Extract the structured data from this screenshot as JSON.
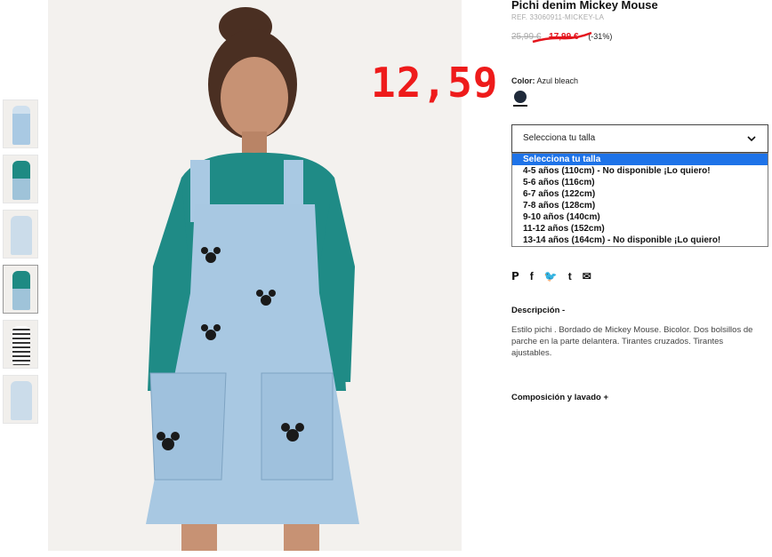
{
  "product": {
    "title": "Pichi denim Mickey Mouse",
    "ref": "REF. 33060911-MICKEY-LA",
    "old_price": "25,99 €",
    "sale_price": "17,99 €",
    "discount": "(-31%)",
    "overlay_price": "12,59",
    "color_label": "Color:",
    "color_value": "Azul bleach"
  },
  "size_select": {
    "selected": "Selecciona tu talla",
    "options": [
      "Selecciona tu talla",
      "4-5 años (110cm) - No disponible ¡Lo quiero!",
      "5-6 años (116cm)",
      "6-7 años (122cm)",
      "7-8 años (128cm)",
      "9-10 años (140cm)",
      "11-12 años (152cm)",
      "13-14 años (164cm) - No disponible ¡Lo quiero!"
    ]
  },
  "share": {
    "pinterest": "𝗣",
    "facebook": "f",
    "twitter": "🐦",
    "tumblr": "t",
    "email": "✉"
  },
  "description": {
    "heading": "Descripción -",
    "text": "Estilo pichi . Bordado de Mickey Mouse. Bicolor. Dos bolsillos de parche en la parte delantera. Tirantes cruzados. Tirantes ajustables."
  },
  "composition": {
    "heading": "Composición y lavado +"
  },
  "colors": {
    "accent_red": "#e4141c",
    "select_highlight": "#1e73e8",
    "swatch": "#1f2a3a"
  }
}
